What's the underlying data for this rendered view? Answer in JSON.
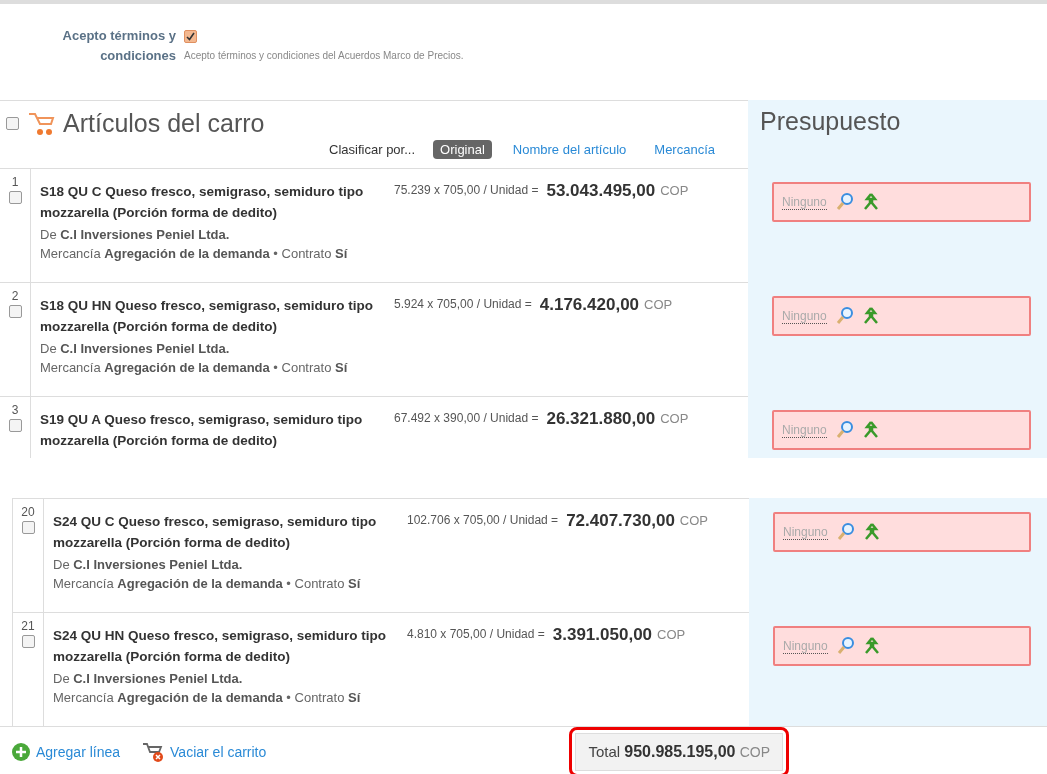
{
  "terms": {
    "label": "Acepto términos y condiciones",
    "checked": true,
    "text": "Acepto términos y condiciones del Acuerdos Marco de Precios."
  },
  "cart": {
    "select_all_checked": false,
    "title": "Artículos del carro",
    "sort_label": "Clasificar por...",
    "sort_options": [
      {
        "label": "Original",
        "selected": true
      },
      {
        "label": "Nombre del artículo",
        "selected": false
      },
      {
        "label": "Mercancía",
        "selected": false
      }
    ],
    "budget_title": "Presupuesto",
    "segments": [
      {
        "rows": [
          {
            "number": "1",
            "checked": false,
            "title": "S18 QU C Queso fresco, semigraso, semiduro tipo mozzarella (Porción forma de dedito)",
            "calc": "75.239 x 705,00 / Unidad =",
            "amount": "53.043.495,00",
            "currency": "COP",
            "supplier": "De **C.I Inversiones Peniel Ltda.**",
            "meta": "Mercancía **Agregación de la demanda** • Contrato **Sí**",
            "budget": "Ninguno"
          },
          {
            "number": "2",
            "checked": false,
            "title": "S18 QU HN Queso fresco, semigraso, semiduro tipo mozzarella (Porción forma de dedito)",
            "calc": "5.924 x 705,00 / Unidad =",
            "amount": "4.176.420,00",
            "currency": "COP",
            "supplier": "De **C.I Inversiones Peniel Ltda.**",
            "meta": "Mercancía **Agregación de la demanda** • Contrato **Sí**",
            "budget": "Ninguno"
          },
          {
            "number": "3",
            "checked": false,
            "title": "S19 QU A Queso fresco, semigraso, semiduro tipo mozzarella (Porción forma de dedito)",
            "calc": "67.492 x 390,00 / Unidad =",
            "amount": "26.321.880,00",
            "currency": "COP",
            "budget": "Ninguno"
          }
        ]
      },
      {
        "rows": [
          {
            "number": "20",
            "checked": false,
            "title": "S24 QU C Queso fresco, semigraso, semiduro tipo mozzarella (Porción forma de dedito)",
            "calc": "102.706 x 705,00 / Unidad =",
            "amount": "72.407.730,00",
            "currency": "COP",
            "supplier": "De **C.I Inversiones Peniel Ltda.**",
            "meta": "Mercancía **Agregación de la demanda** • Contrato **Sí**",
            "budget": "Ninguno"
          },
          {
            "number": "21",
            "checked": false,
            "title": "S24 QU HN Queso fresco, semigraso, semiduro tipo mozzarella (Porción forma de dedito)",
            "calc": "4.810 x 705,00 / Unidad =",
            "amount": "3.391.050,00",
            "currency": "COP",
            "supplier": "De **C.I Inversiones Peniel Ltda.**",
            "meta": "Mercancía **Agregación de la demanda** • Contrato **Sí**",
            "budget": "Ninguno"
          }
        ]
      }
    ],
    "footer": {
      "add_line": "Agregar línea",
      "empty_cart": "Vaciar el carrito",
      "total_label": "Total",
      "total": "950.985.195,00",
      "currency": "COP"
    }
  }
}
